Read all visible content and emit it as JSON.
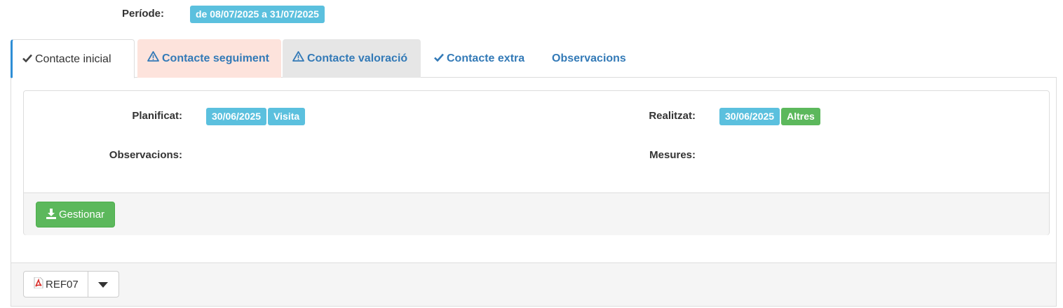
{
  "period": {
    "label": "Període:",
    "value": "de 08/07/2025 a 31/07/2025"
  },
  "tabs": [
    {
      "label": "Contacte inicial",
      "icon": "check-icon"
    },
    {
      "label": "Contacte seguiment",
      "icon": "warning-icon"
    },
    {
      "label": "Contacte valoració",
      "icon": "warning-icon"
    },
    {
      "label": "Contacte extra",
      "icon": "check-icon"
    },
    {
      "label": "Observacions"
    }
  ],
  "details": {
    "planificat": {
      "label": "Planificat:",
      "date": "30/06/2025",
      "type": "Visita"
    },
    "realitzat": {
      "label": "Realitzat:",
      "date": "30/06/2025",
      "type": "Altres"
    },
    "observacions": {
      "label": "Observacions:",
      "value": ""
    },
    "mesures": {
      "label": "Mesures:",
      "value": ""
    }
  },
  "actions": {
    "gestionar_label": "Gestionar",
    "report_label": "REF07"
  },
  "colors": {
    "info_badge": "#5bc0de",
    "success_badge": "#5cb85c",
    "link_blue": "#337ab7",
    "warning_tab_bg": "#fde3dc",
    "grey_tab_bg": "#e6e6e6",
    "active_tab_border": "#2e8ed6"
  }
}
